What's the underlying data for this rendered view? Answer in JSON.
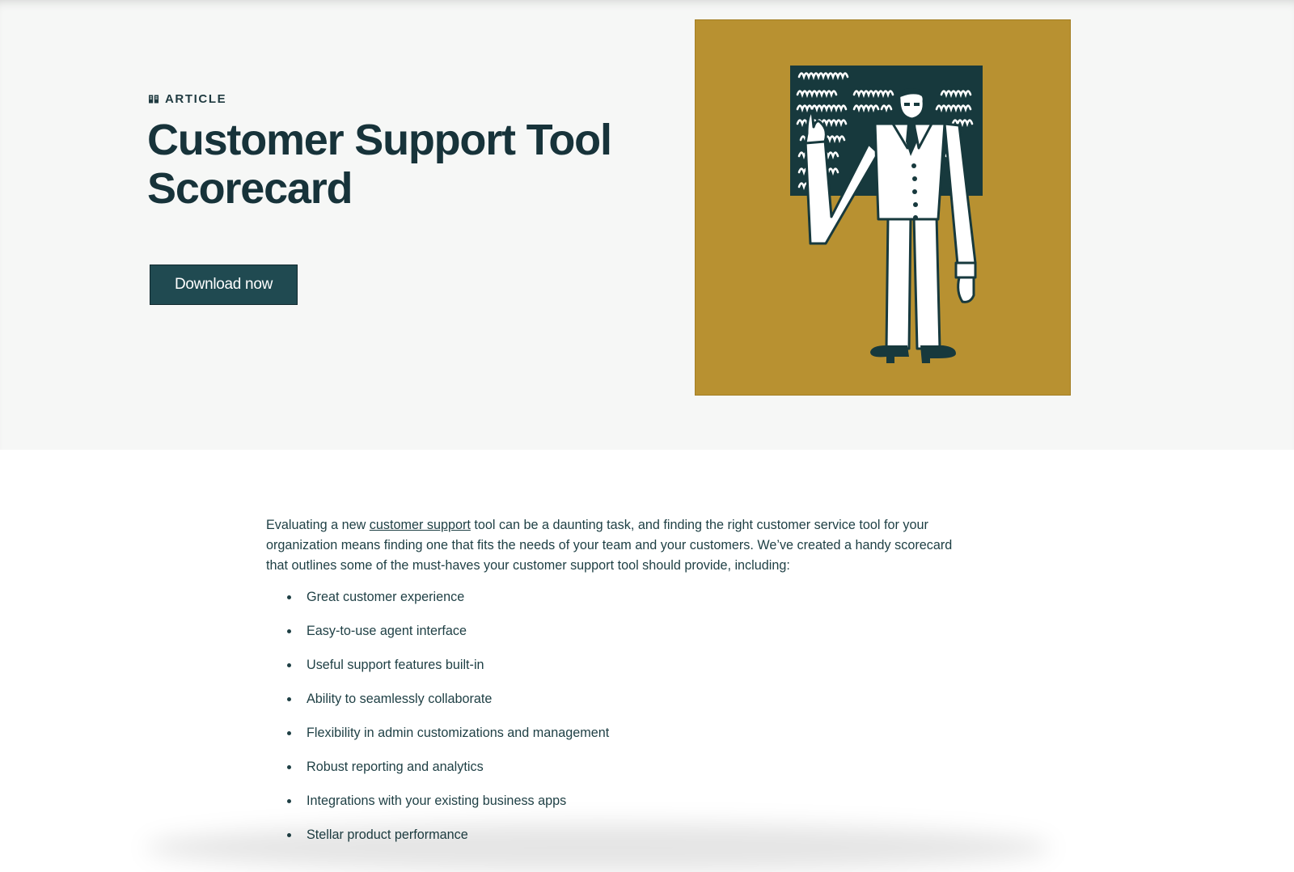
{
  "hero": {
    "eyebrow_label": "ARTICLE",
    "eyebrow_icon": "book-icon",
    "title": "Customer Support Tool Scorecard",
    "download_label": "Download now",
    "illustration_alt": "",
    "colors": {
      "background": "#f6f7f6",
      "illustration_bg": "#b89131",
      "button_bg": "#204a51",
      "heading": "#17333a"
    }
  },
  "body": {
    "intro_before": "Evaluating a new ",
    "intro_link": "customer support",
    "intro_after": " tool can be a daunting task, and finding the right customer service tool for your organization means finding one that fits the needs of your team and your customers. We’ve created a handy scorecard that outlines some of the must-haves your customer support tool should provide, including:",
    "features": [
      "Great customer experience",
      "Easy-to-use agent interface",
      "Useful support features built-in",
      "Ability to seamlessly collaborate",
      "Flexibility in admin customizations and management",
      "Robust reporting and analytics",
      "Integrations with your existing business apps",
      "Stellar product performance"
    ]
  }
}
